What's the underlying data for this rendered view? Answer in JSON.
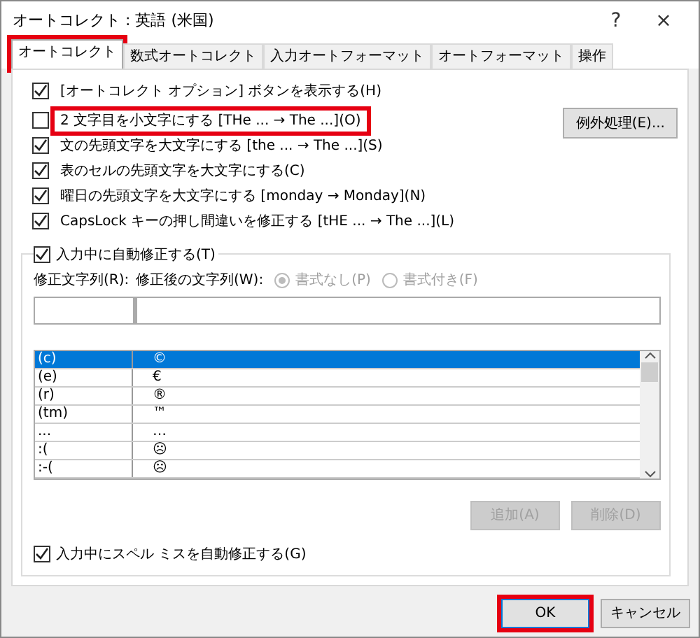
{
  "window": {
    "title": "オートコレクト : 英語 (米国)",
    "help": "?",
    "close": "×"
  },
  "tabs": [
    {
      "label": "オートコレクト",
      "selected": true,
      "highlighted": true
    },
    {
      "label": "数式オートコレクト",
      "selected": false,
      "highlighted": false
    },
    {
      "label": "入力オートフォーマット",
      "selected": false,
      "highlighted": false
    },
    {
      "label": "オートフォーマット",
      "selected": false,
      "highlighted": false
    },
    {
      "label": "操作",
      "selected": false,
      "highlighted": false
    }
  ],
  "options": [
    {
      "label": "[オートコレクト オプション] ボタンを表示する(H)",
      "checked": true,
      "highlighted": false
    },
    {
      "label": "2 文字目を小文字にする [THe ... → The ...](O)",
      "checked": false,
      "highlighted": true
    },
    {
      "label": "文の先頭文字を大文字にする [the ... → The ...](S)",
      "checked": true,
      "highlighted": false
    },
    {
      "label": "表のセルの先頭文字を大文字にする(C)",
      "checked": true,
      "highlighted": false
    },
    {
      "label": "曜日の先頭文字を大文字にする [monday → Monday](N)",
      "checked": true,
      "highlighted": false
    },
    {
      "label": "CapsLock キーの押し間違いを修正する [tHE ... → The ...](L)",
      "checked": true,
      "highlighted": false
    }
  ],
  "exceptions_button": {
    "label": "例外処理(E)..."
  },
  "replace_group": {
    "label": "入力中に自動修正する(T)",
    "checked": true,
    "replace_label": "修正文字列(R):",
    "with_label": "修正後の文字列(W):",
    "format_options": [
      {
        "label": "書式なし(P)",
        "selected": true,
        "disabled": true
      },
      {
        "label": "書式付き(F)",
        "selected": false,
        "disabled": true
      }
    ],
    "entries": [
      {
        "replace": "(c)",
        "with": "©",
        "selected": true
      },
      {
        "replace": "(e)",
        "with": "€",
        "selected": false
      },
      {
        "replace": "(r)",
        "with": "®",
        "selected": false
      },
      {
        "replace": "(tm)",
        "with": "™",
        "selected": false
      },
      {
        "replace": "...",
        "with": "…",
        "selected": false
      },
      {
        "replace": ":(",
        "with": "☹",
        "selected": false
      },
      {
        "replace": ":-(",
        "with": "☹",
        "selected": false
      }
    ],
    "buttons": [
      {
        "label": "追加(A)",
        "disabled": true
      },
      {
        "label": "削除(D)",
        "disabled": true
      }
    ],
    "spelling_option": {
      "label": "入力中にスペル ミスを自動修正する(G)",
      "checked": true
    }
  },
  "buttons": [
    {
      "label": "OK",
      "highlighted": true
    },
    {
      "label": "キャンセル",
      "highlighted": false
    }
  ]
}
